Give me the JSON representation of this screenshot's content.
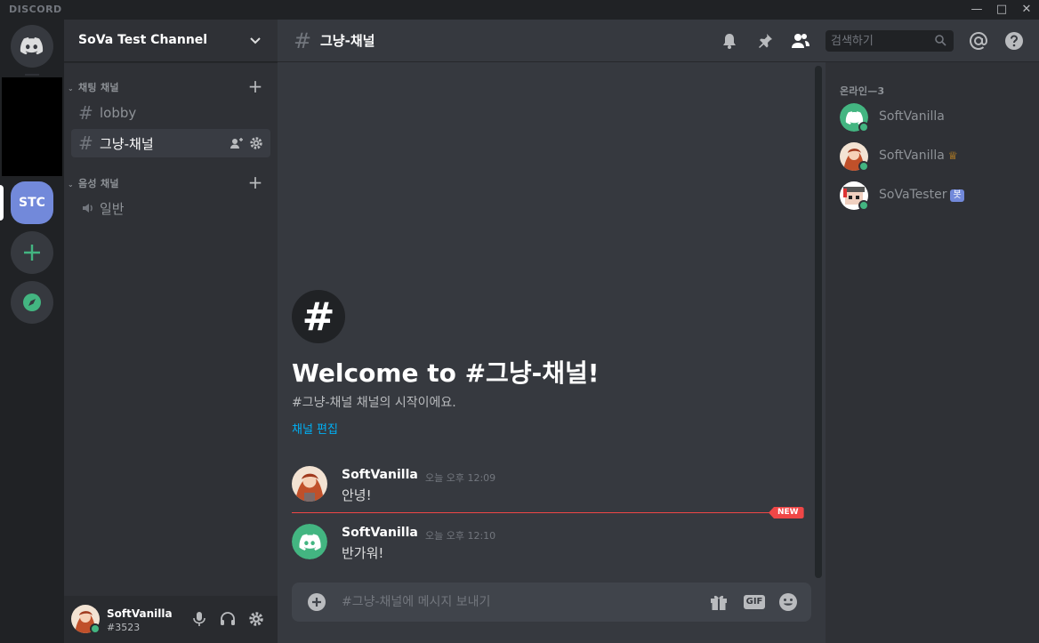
{
  "app": {
    "brand": "DISCORD",
    "window_controls": [
      "minimize",
      "maximize",
      "close"
    ]
  },
  "servers": {
    "home_icon": "discord-logo-icon",
    "active_server": {
      "label": "STC"
    },
    "add_server_icon": "plus-icon",
    "explore_icon": "compass-icon",
    "colors": {
      "active": "#7289da",
      "green": "#43b581"
    }
  },
  "sidebar": {
    "guild_name": "SoVa Test Channel",
    "categories": [
      {
        "label": "채팅 채널",
        "channels": [
          {
            "label": "lobby",
            "type": "text"
          },
          {
            "label": "그냥-채널",
            "type": "text",
            "active": true
          }
        ]
      },
      {
        "label": "음성 채널",
        "channels": [
          {
            "label": "일반",
            "type": "voice"
          }
        ]
      }
    ]
  },
  "user_panel": {
    "username": "SoftVanilla",
    "tag": "#3523",
    "status": "online"
  },
  "chat": {
    "channel_name": "그냥-채널",
    "search_placeholder": "검색하기",
    "welcome_title": "Welcome to #그냥-채널!",
    "welcome_sub": "#그냥-채널 채널의 시작이에요.",
    "edit_channel_link": "채널 편집",
    "messages": [
      {
        "author": "SoftVanilla",
        "time": "오늘 오후 12:09",
        "text": "안녕!",
        "avatar": "anime-avatar"
      },
      {
        "author": "SoftVanilla",
        "time": "오늘 오후 12:10",
        "text": "반가워!",
        "avatar": "discord-default-avatar"
      }
    ],
    "new_badge": "NEW",
    "composer_placeholder": "#그냥-채널에 메시지 보내기"
  },
  "members": {
    "header": "온라인—3",
    "list": [
      {
        "name": "SoftVanilla",
        "avatar": "discord-default-avatar",
        "badge": ""
      },
      {
        "name": "SoftVanilla",
        "avatar": "anime-avatar",
        "badge": "crown"
      },
      {
        "name": "SoVaTester",
        "avatar": "pixel-avatar",
        "badge": "봇"
      }
    ]
  }
}
